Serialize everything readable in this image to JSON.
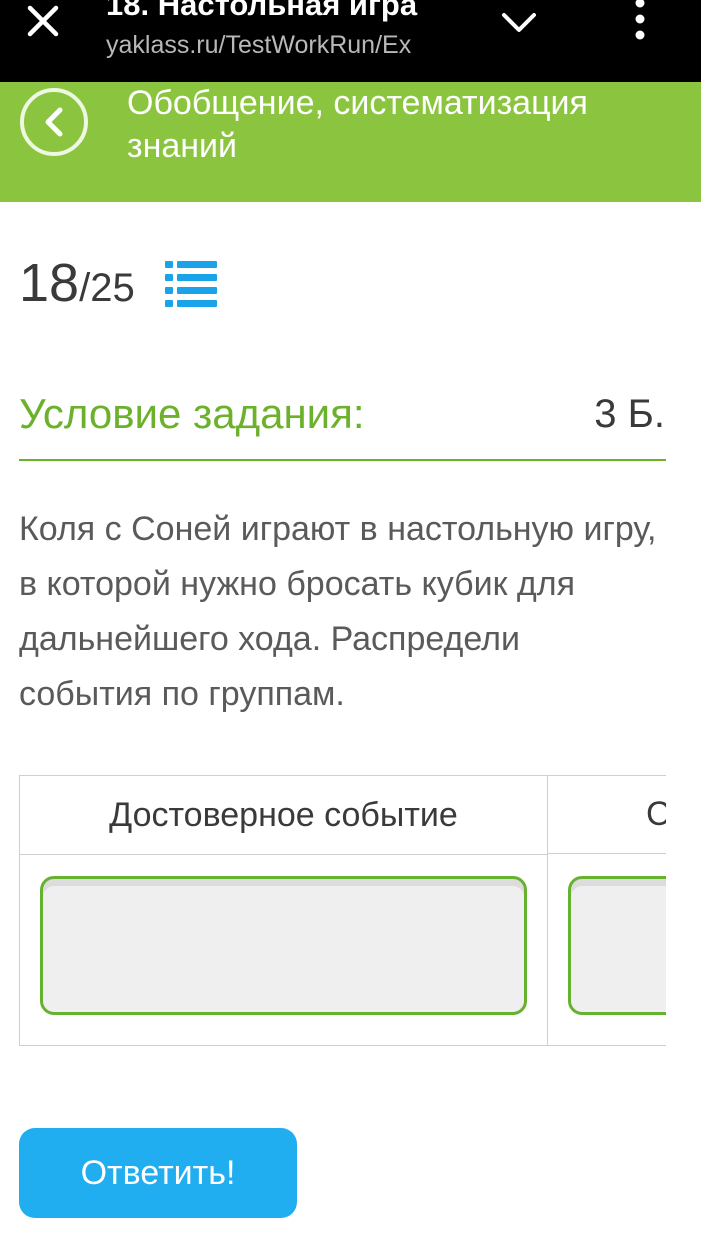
{
  "browser": {
    "tab_title": "18. Настольная игра",
    "url": "yaklass.ru/TestWorkRun/Ex"
  },
  "header": {
    "title": "Обобщение, систематизация знаний",
    "accent_color": "#8bc53f"
  },
  "progress": {
    "current": "18",
    "separator": "/",
    "total": "25"
  },
  "task": {
    "label": "Условие задания:",
    "points": "3 Б.",
    "question": "Коля с Соней играют в настольную игру, в которой нужно бросать кубик для дальнейшего хода. Распредели события по группам."
  },
  "groups": [
    {
      "title": "Достоверное событие"
    },
    {
      "title": "С"
    }
  ],
  "submit": {
    "label": "Ответить!",
    "color": "#21aef0"
  },
  "icons": {
    "close": "close-icon",
    "chevron": "chevron-down-icon",
    "more": "more-vertical-icon",
    "back": "back-arrow-icon",
    "list": "list-icon"
  }
}
